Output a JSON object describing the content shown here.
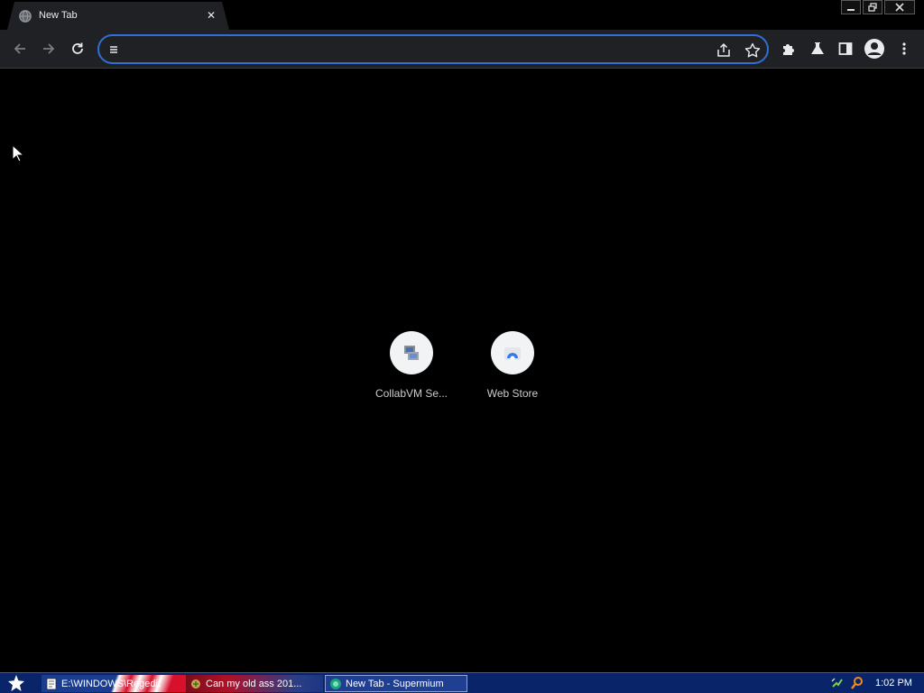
{
  "browser": {
    "tab": {
      "title": "New Tab",
      "close_glyph": "✕",
      "favicon": "globe-icon"
    },
    "window_controls": {
      "minimize": "minimize-icon",
      "restore": "restore-icon",
      "close": "close-icon"
    },
    "toolbar": {
      "back": "back-arrow-icon",
      "forward": "forward-arrow-icon",
      "reload": "reload-icon",
      "omnibox": {
        "value": "",
        "placeholder": "",
        "share": "share-icon",
        "bookmark": "star-icon"
      },
      "extensions": "puzzle-icon",
      "labs": "flask-icon",
      "side_panel": "side-panel-icon",
      "profile": "avatar-icon",
      "menu": "more-vert-icon"
    },
    "accent_color": "#2f6fd6"
  },
  "new_tab": {
    "shortcuts": [
      {
        "label": "CollabVM Se...",
        "icon": "collabvm-icon"
      },
      {
        "label": "Web Store",
        "icon": "web-store-icon"
      }
    ]
  },
  "taskbar": {
    "tasks": [
      {
        "label": "E:\\WINDOWS\\Regedit",
        "icon": "notepad-icon"
      },
      {
        "label": "Can my old ass 201...",
        "icon": "app-icon"
      },
      {
        "label": "New Tab - Supermium",
        "icon": "supermium-icon",
        "active": true
      }
    ],
    "clock": "1:02 PM",
    "colors": {
      "bar": "#0a246a"
    }
  }
}
